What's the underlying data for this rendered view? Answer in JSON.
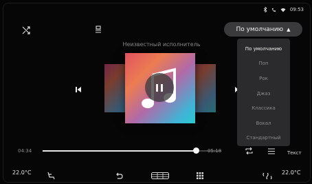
{
  "status_bar": {
    "time": "09:53"
  },
  "preset": {
    "button_label": "По умолчанию",
    "options": [
      {
        "label": "По умолчанию",
        "selected": true
      },
      {
        "label": "Поп",
        "selected": false
      },
      {
        "label": "Рок",
        "selected": false
      },
      {
        "label": "Джаз",
        "selected": false
      },
      {
        "label": "Классика",
        "selected": false
      },
      {
        "label": "Вокал",
        "selected": false
      },
      {
        "label": "Стандартный",
        "selected": false
      }
    ]
  },
  "player": {
    "artist": "Неизвестный исполнитель",
    "elapsed": "04:34",
    "duration": "05:18",
    "progress": 0.86
  },
  "controls": {
    "text_button": "Текст"
  },
  "bottom_bar": {
    "temp_left": "22.0°C",
    "temp_right": "22.0°C"
  },
  "colors": {
    "background": "#050505",
    "menu_bg": "#2b2b2d",
    "button_bg": "#3a3a3c"
  }
}
